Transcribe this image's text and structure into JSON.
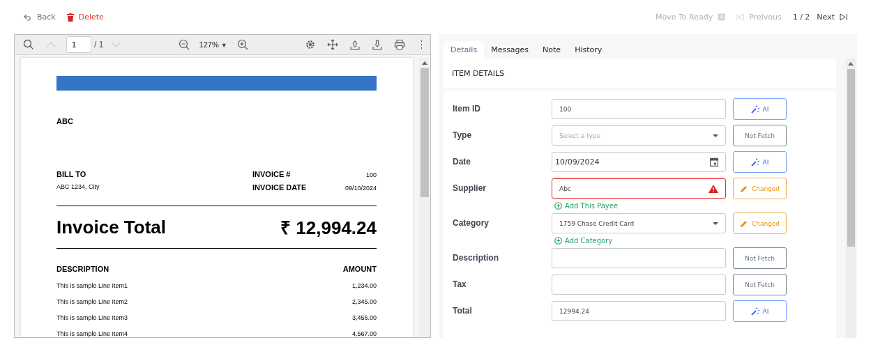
{
  "top_bar": {
    "back": "Back",
    "delete": "Delete",
    "move_to_ready": {
      "label": "Move To Ready",
      "disabled": true
    },
    "previous": {
      "label": "Prelvous",
      "disabled": true
    },
    "pager": "1 / 2",
    "next": {
      "label": "Next",
      "disabled": false
    }
  },
  "viewer": {
    "toolbar": {
      "page_value": "1",
      "page_total": "/ 1",
      "zoom": "127%",
      "zoom_caret": "▼"
    },
    "invoice": {
      "company": "ABC",
      "bill_to_label": "BILL TO",
      "bill_to": "ABC 1234, City",
      "meta": [
        {
          "label": "INVOICE #",
          "value": "100"
        },
        {
          "label": "INVOICE DATE",
          "value": "09/10/2024"
        }
      ],
      "total_label": "Invoice Total",
      "total": "₹ 12,994.24",
      "desc_header": "DESCRIPTION",
      "amount_header": "AMOUNT",
      "lines": [
        {
          "description": "This is sample Line Item1",
          "amount": "1,234.00"
        },
        {
          "description": "This is sample Line Item2",
          "amount": "2,345.00"
        },
        {
          "description": "This is sample Line Item3",
          "amount": "3,456.00"
        },
        {
          "description": "This is sample Line Item4",
          "amount": "4,567.00"
        }
      ]
    }
  },
  "tabs": [
    {
      "label": "Details",
      "selected": true
    },
    {
      "label": "Messages",
      "selected": false
    },
    {
      "label": "Note",
      "selected": false
    },
    {
      "label": "History",
      "selected": false
    }
  ],
  "section_title": "ITEM DETAILS",
  "fields": [
    {
      "label": "Item ID",
      "kind": "text",
      "value": "100",
      "error": false,
      "action": {
        "kind": "ai",
        "label": "AI"
      }
    },
    {
      "label": "Type",
      "kind": "select",
      "placeholder": "Select a type",
      "error": false,
      "action": {
        "kind": "not_fetch",
        "label": "Not Fetch"
      }
    },
    {
      "label": "Date",
      "kind": "date",
      "value": "10/09/2024",
      "error": false,
      "action": {
        "kind": "ai",
        "label": "AI"
      }
    },
    {
      "label": "Supplier",
      "kind": "text",
      "value": "Abc",
      "error": true,
      "link": "Add This Payee",
      "action": {
        "kind": "changed",
        "label": "Changed"
      }
    },
    {
      "label": "Category",
      "kind": "select",
      "value": "1759 Chase Credit Card",
      "error": false,
      "link": "Add Category",
      "action": {
        "kind": "changed",
        "label": "Changed"
      }
    },
    {
      "label": "Description",
      "kind": "text",
      "error": false,
      "action": {
        "kind": "not_fetch",
        "label": "Not Fetch"
      }
    },
    {
      "label": "Tax",
      "kind": "text",
      "error": false,
      "action": {
        "kind": "not_fetch",
        "label": "Not Fetch"
      }
    },
    {
      "label": "Total",
      "kind": "text",
      "value": "12994.24",
      "error": false,
      "action": {
        "kind": "ai",
        "label": "AI"
      }
    }
  ]
}
